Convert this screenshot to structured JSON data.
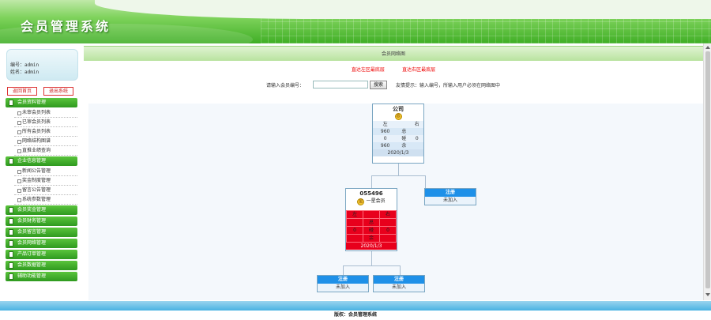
{
  "header": {
    "title": "会员管理系统"
  },
  "sidebar": {
    "user": {
      "id_line": "编号：admin",
      "name_line": "姓名：admin"
    },
    "buttons": {
      "home": "返回首页",
      "logout": "退出系统"
    },
    "groups": [
      {
        "title": "会员资料管理",
        "items": [
          "未审会员列表",
          "已审会员列表",
          "所有会员列表",
          "网络结构图谱",
          "直推业绩查询"
        ]
      },
      {
        "title": "企业信息管理",
        "items": [
          "新闻公告管理",
          "奖金制度管理",
          "留言公告管理",
          "系统参数管理"
        ]
      },
      {
        "title": "会员奖金管理",
        "items": []
      },
      {
        "title": "会员财务管理",
        "items": []
      },
      {
        "title": "会员留言管理",
        "items": []
      },
      {
        "title": "会员网络管理",
        "items": []
      },
      {
        "title": "产品订单管理",
        "items": []
      },
      {
        "title": "会员数据管理",
        "items": []
      },
      {
        "title": "辅助功能管理",
        "items": []
      }
    ]
  },
  "main": {
    "title": "会员网络图",
    "links": {
      "left_top": "直达左区最底层",
      "right_top": "直达右区最底层"
    },
    "search": {
      "label": "请输入会员编号：",
      "value": "",
      "button": "搜索",
      "hint": "友情提示：输入编号，所输入用户必须在网络图中"
    },
    "root": {
      "id": "公司",
      "badge": "总",
      "rows": [
        [
          "左",
          "",
          "右"
        ],
        [
          "960",
          "总",
          ""
        ],
        [
          "0",
          "碰",
          "0"
        ],
        [
          "960",
          "余",
          ""
        ]
      ],
      "date": "2020/1/3"
    },
    "member": {
      "id": "055496",
      "badge": "星",
      "level": "一星会员",
      "rows": [
        [
          "左",
          "",
          "右"
        ],
        [
          "",
          "总",
          ""
        ],
        [
          "0",
          "碰",
          "0"
        ],
        [
          "",
          "余",
          ""
        ]
      ],
      "date": "2020/1/3"
    },
    "slot": {
      "head": "注册",
      "body": "未加入"
    }
  },
  "footer": {
    "text": "版权：会员管理系统"
  },
  "colors": {
    "header_green": "#3fae25",
    "menu_green": "#2f9a1f",
    "member_red": "#e8001c",
    "slot_blue": "#1e90e8"
  }
}
